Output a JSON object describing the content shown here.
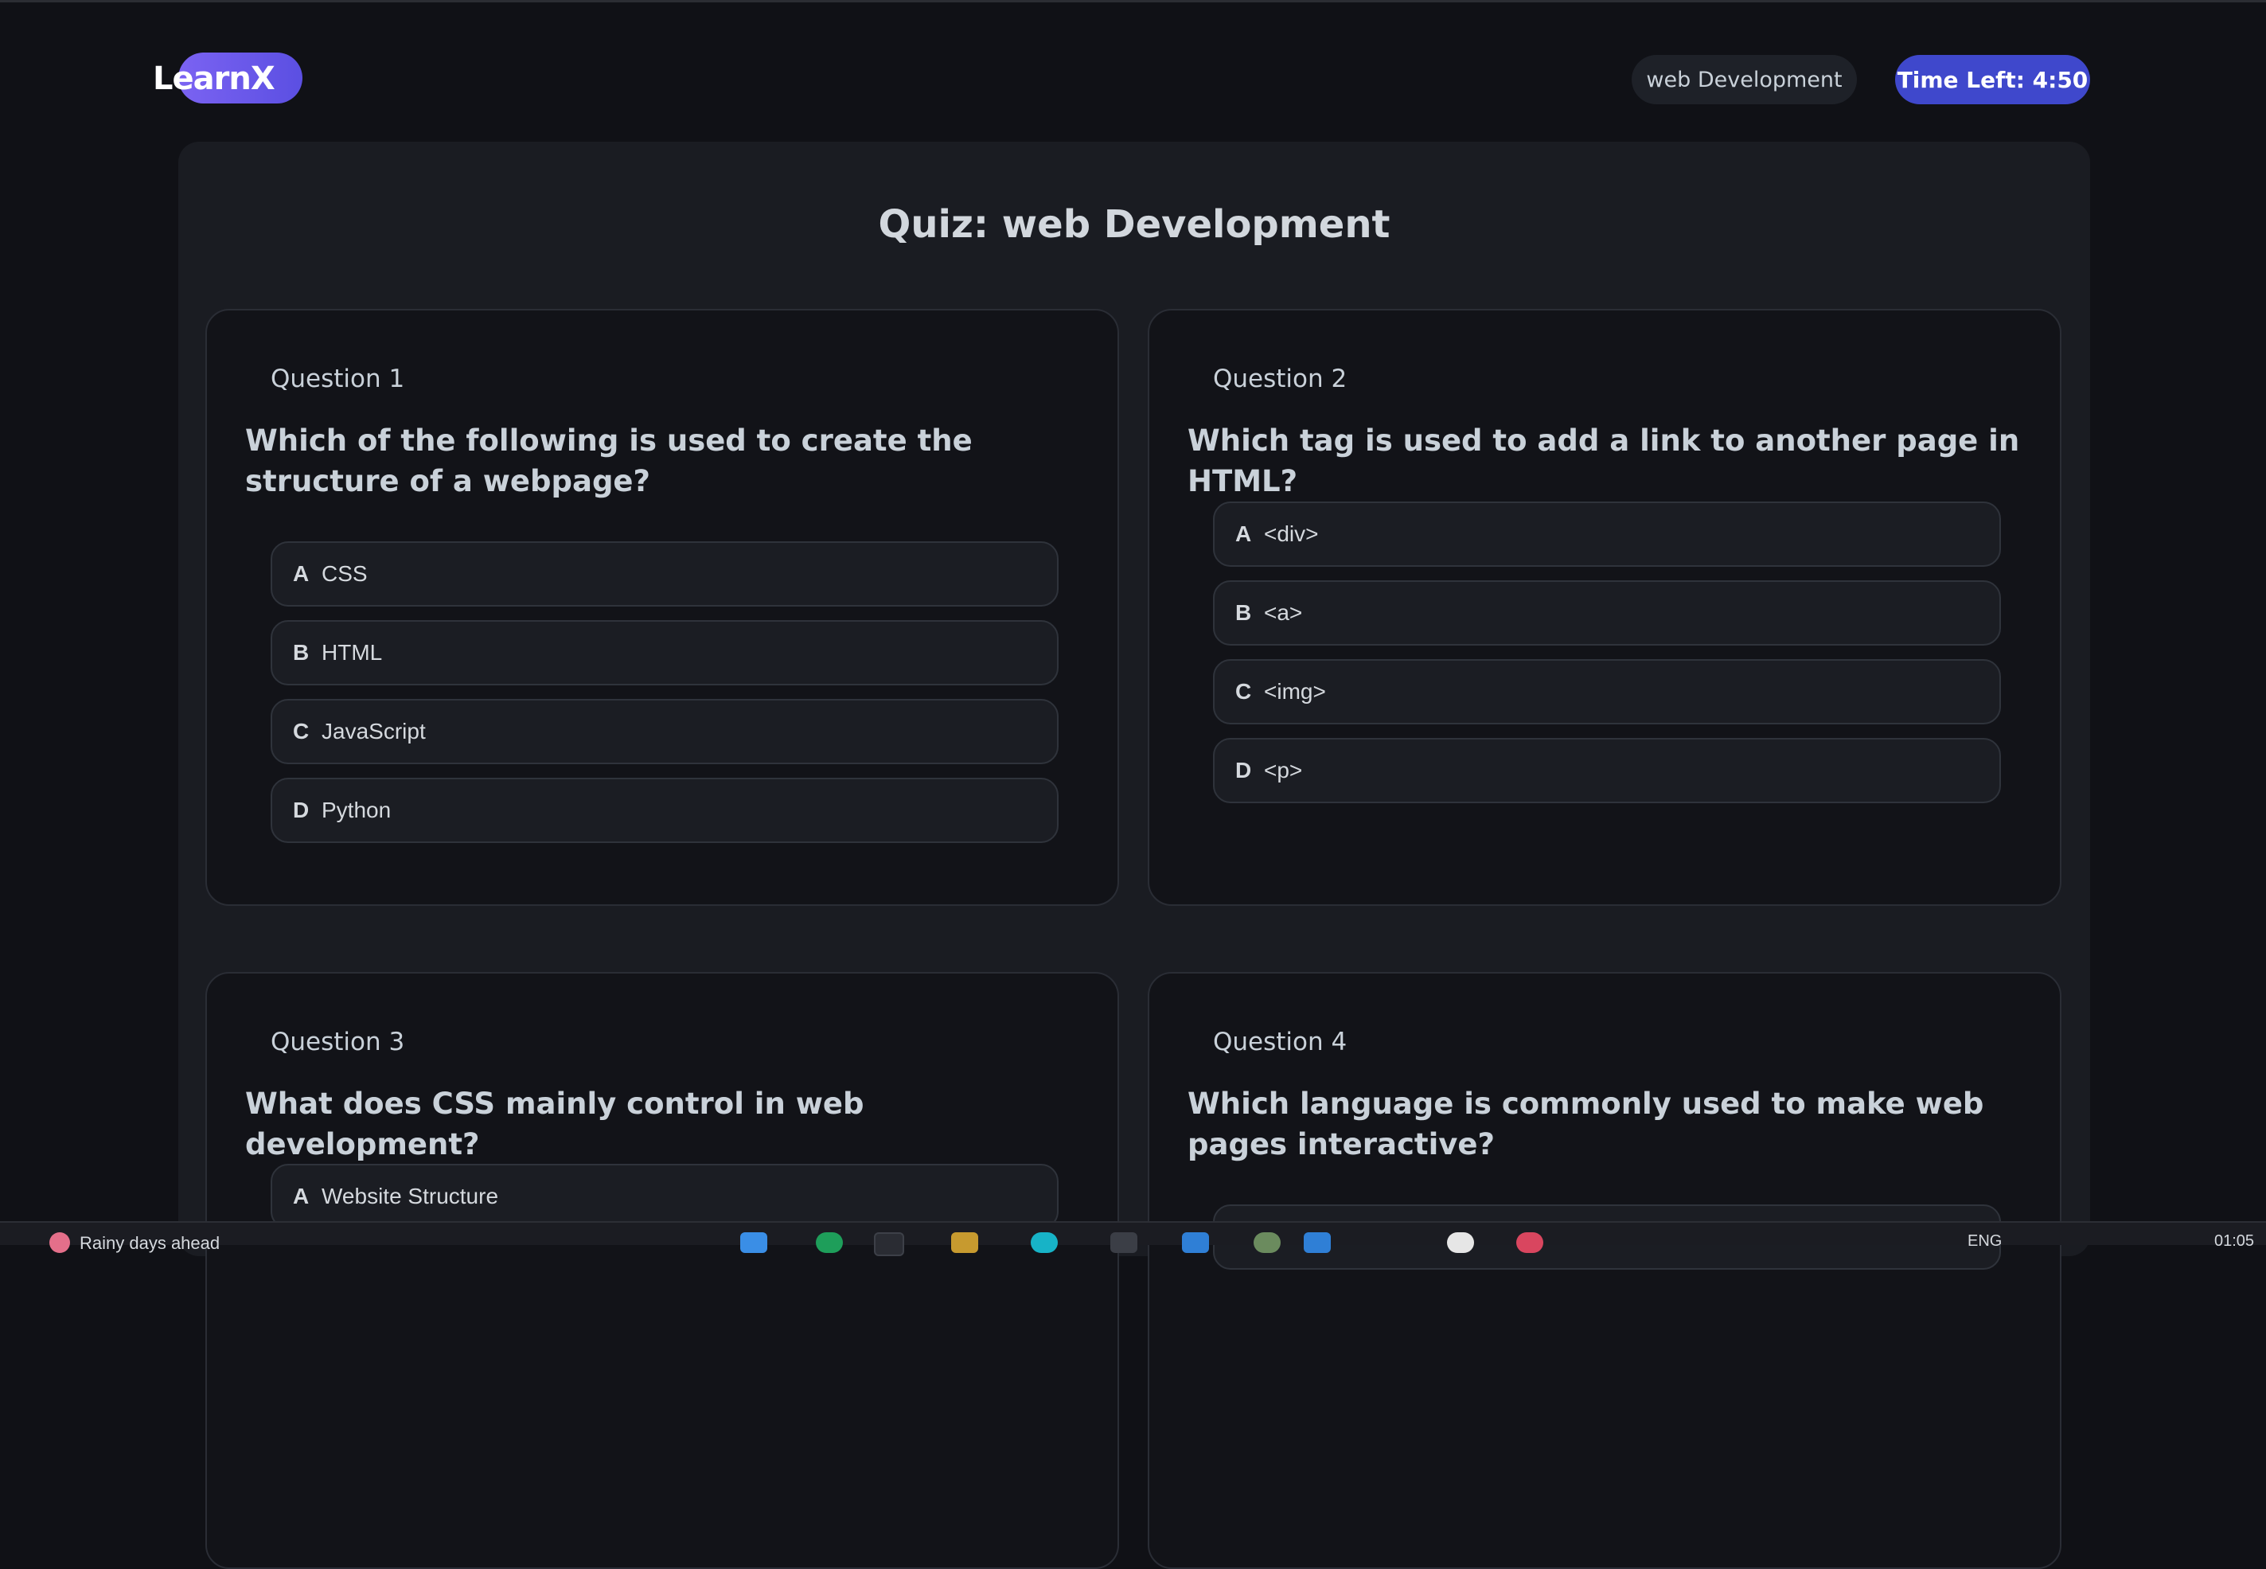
{
  "header": {
    "logo": "LearnX",
    "subject": "web Development",
    "timer": "Time Left: 4:50"
  },
  "quiz": {
    "title": "Quiz: web Development",
    "questions": [
      {
        "label": "Question 1",
        "text": "Which of the following is used to create the structure of a webpage?",
        "options": [
          {
            "letter": "A",
            "text": "CSS"
          },
          {
            "letter": "B",
            "text": "HTML"
          },
          {
            "letter": "C",
            "text": "JavaScript"
          },
          {
            "letter": "D",
            "text": "Python"
          }
        ]
      },
      {
        "label": "Question 2",
        "text": "Which tag is used to add a link to another page in HTML?",
        "options": [
          {
            "letter": "A",
            "text": "<div>"
          },
          {
            "letter": "B",
            "text": "<a>"
          },
          {
            "letter": "C",
            "text": "<img>"
          },
          {
            "letter": "D",
            "text": "<p>"
          }
        ]
      },
      {
        "label": "Question 3",
        "text": "What does CSS mainly control in web development?",
        "options": [
          {
            "letter": "A",
            "text": "Website Structure"
          }
        ]
      },
      {
        "label": "Question 4",
        "text": "Which language is commonly used to make web pages interactive?",
        "options": []
      }
    ]
  },
  "taskbar": {
    "weather": "Rainy days ahead",
    "language": "ENG",
    "time": "01:05"
  },
  "colors": {
    "background": "#101116",
    "panel": "#1a1c22",
    "card": "#121318",
    "accent": "#3f48cc",
    "logo_gradient_start": "#7b63f2",
    "logo_gradient_end": "#5b4fe2"
  }
}
